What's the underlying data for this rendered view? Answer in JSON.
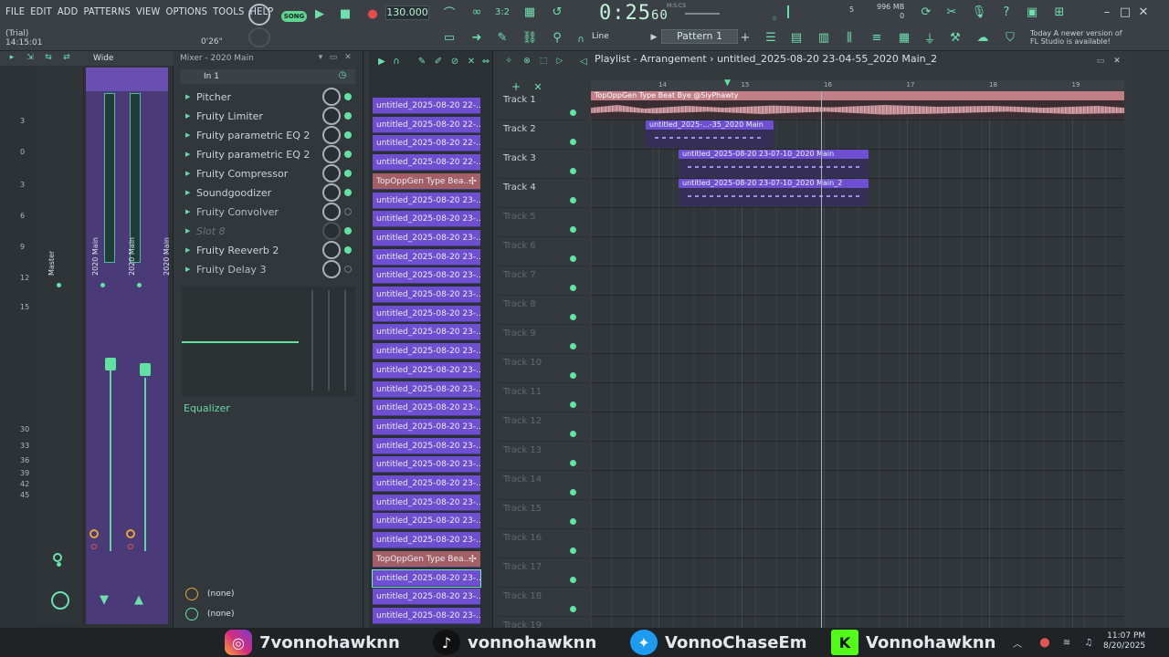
{
  "menu": [
    "FILE",
    "EDIT",
    "ADD",
    "PATTERNS",
    "VIEW",
    "OPTIONS",
    "TOOLS",
    "HELP"
  ],
  "toolbar": {
    "trial": "(Trial)",
    "session_time": "14:15:01",
    "preview_time": "0'26\"",
    "song_mode": "SONG",
    "tempo": "130.000",
    "time_main": "0:25",
    "time_sub": "60",
    "time_unit": "M:S:CS",
    "cpu_value": "5",
    "mem_value": "996 MB",
    "mem_sub": "0",
    "snap": "Line",
    "pattern": "Pattern 1",
    "news_line1": "Today  A newer version of",
    "news_line2": "FL Studio is available!"
  },
  "mixer": {
    "view": "Wide",
    "scale": [
      "3",
      "0",
      "3",
      "6",
      "9",
      "12",
      "15",
      "30",
      "33",
      "36",
      "39",
      "42",
      "45"
    ],
    "master_label": "Master",
    "strip1_label": "2020 Main",
    "strip2_label": "2020 Main",
    "strip3_label": "2020 Main"
  },
  "inserts": {
    "title": "Mixer - 2020 Main",
    "input": "In 1",
    "slots": [
      {
        "name": "Pitcher",
        "active": true
      },
      {
        "name": "Fruity Limiter",
        "active": true
      },
      {
        "name": "Fruity parametric EQ 2",
        "active": true
      },
      {
        "name": "Fruity parametric EQ 2",
        "active": true
      },
      {
        "name": "Fruity Compressor",
        "active": true
      },
      {
        "name": "Soundgoodizer",
        "active": true
      },
      {
        "name": "Fruity Convolver",
        "active": false
      },
      {
        "name": "Slot 8",
        "active": false
      },
      {
        "name": "Fruity Reeverb 2",
        "active": true
      },
      {
        "name": "Fruity Delay 3",
        "active": false
      }
    ],
    "eq_label": "Equalizer",
    "route1": "(none)",
    "route2": "(none)"
  },
  "picker": {
    "items": [
      {
        "label": "untitled_2025-08-20 22-...",
        "type": "pattern"
      },
      {
        "label": "untitled_2025-08-20 22-...",
        "type": "pattern"
      },
      {
        "label": "untitled_2025-08-20 22-...",
        "type": "pattern"
      },
      {
        "label": "untitled_2025-08-20 22-...",
        "type": "pattern"
      },
      {
        "label": "TopOppGen Type Bea...",
        "type": "audio"
      },
      {
        "label": "untitled_2025-08-20 23-...",
        "type": "pattern"
      },
      {
        "label": "untitled_2025-08-20 23-...",
        "type": "pattern"
      },
      {
        "label": "untitled_2025-08-20 23-...",
        "type": "pattern"
      },
      {
        "label": "untitled_2025-08-20 23-...",
        "type": "pattern"
      },
      {
        "label": "untitled_2025-08-20 23-...",
        "type": "pattern"
      },
      {
        "label": "untitled_2025-08-20 23-...",
        "type": "pattern"
      },
      {
        "label": "untitled_2025-08-20 23-...",
        "type": "pattern"
      },
      {
        "label": "untitled_2025-08-20 23-...",
        "type": "pattern"
      },
      {
        "label": "untitled_2025-08-20 23-...",
        "type": "pattern"
      },
      {
        "label": "untitled_2025-08-20 23-...",
        "type": "pattern"
      },
      {
        "label": "untitled_2025-08-20 23-...",
        "type": "pattern"
      },
      {
        "label": "untitled_2025-08-20 23-...",
        "type": "pattern"
      },
      {
        "label": "untitled_2025-08-20 23-...",
        "type": "pattern"
      },
      {
        "label": "untitled_2025-08-20 23-...",
        "type": "pattern"
      },
      {
        "label": "untitled_2025-08-20 23-...",
        "type": "pattern"
      },
      {
        "label": "untitled_2025-08-20 23-...",
        "type": "pattern"
      },
      {
        "label": "untitled_2025-08-20 23-...",
        "type": "pattern"
      },
      {
        "label": "untitled_2025-08-20 23-...",
        "type": "pattern"
      },
      {
        "label": "untitled_2025-08-20 23-...",
        "type": "pattern"
      },
      {
        "label": "TopOppGen Type Bea...",
        "type": "audio"
      },
      {
        "label": "untitled_2025-08-20 23-...",
        "type": "pattern",
        "selected": true
      },
      {
        "label": "untitled_2025-08-20 23-...",
        "type": "pattern"
      },
      {
        "label": "untitled_2025-08-20 23-...",
        "type": "pattern"
      },
      {
        "label": "untitled_2025-08-20 23-...",
        "type": "pattern"
      }
    ]
  },
  "playlist": {
    "title": "Playlist - Arrangement",
    "project": "untitled_2025-08-20 23-04-55_2020 Main_2",
    "ruler": [
      "14",
      "15",
      "16",
      "17",
      "18",
      "19"
    ],
    "tracks": [
      "Track 1",
      "Track 2",
      "Track 3",
      "Track 4",
      "Track 5",
      "Track 6",
      "Track 7",
      "Track 8",
      "Track 9",
      "Track 10",
      "Track 11",
      "Track 12",
      "Track 13",
      "Track 14",
      "Track 15",
      "Track 16",
      "Track 17",
      "Track 18",
      "Track 19"
    ],
    "clips": {
      "audio": "TopOppGen Type Beat Bye @SlyPhawty",
      "clip2": "untitled_2025-...-35_2020 Main",
      "clip3": "untitled_2025-08-20 23-07-10_2020 Main",
      "clip4": "untitled_2025-08-20 23-07-10_2020 Main_2"
    }
  },
  "taskbar": {
    "instagram": "7vonnohawknn",
    "tiktok": "vonnohawknn",
    "twitter": "VonnoChaseEm",
    "kick": "Vonnohawknn",
    "clock_time": "11:07 PM",
    "clock_date": "8/20/2025"
  },
  "colors": {
    "accent_green": "#5fe3a0",
    "pattern_purple": "#6e4fd1",
    "audio_pink": "#c27f88"
  }
}
